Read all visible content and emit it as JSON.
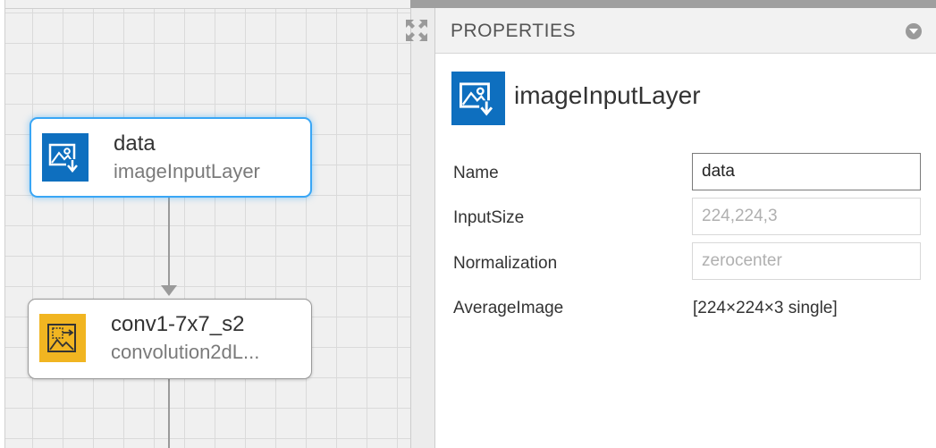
{
  "canvas": {
    "nodes": [
      {
        "name": "data",
        "type": "imageInputLayer",
        "icon": "image-input-icon",
        "color": "#0e6fbf",
        "selected": true
      },
      {
        "name": "conv1-7x7_s2",
        "type": "convolution2dL...",
        "icon": "convolution-icon",
        "color": "#f1b521",
        "selected": false
      }
    ]
  },
  "panel": {
    "title": "PROPERTIES",
    "layer_name": "imageInputLayer",
    "layer_icon": "image-input-icon",
    "properties": {
      "name": {
        "label": "Name",
        "value": "data"
      },
      "input_size": {
        "label": "InputSize",
        "value": "224,224,3"
      },
      "normalization": {
        "label": "Normalization",
        "value": "zerocenter"
      },
      "average_image": {
        "label": "AverageImage",
        "value": "[224×224×3 single]"
      }
    }
  },
  "colors": {
    "selection": "#39a6f5",
    "input_layer": "#0e6fbf",
    "conv_layer": "#f1b521"
  }
}
